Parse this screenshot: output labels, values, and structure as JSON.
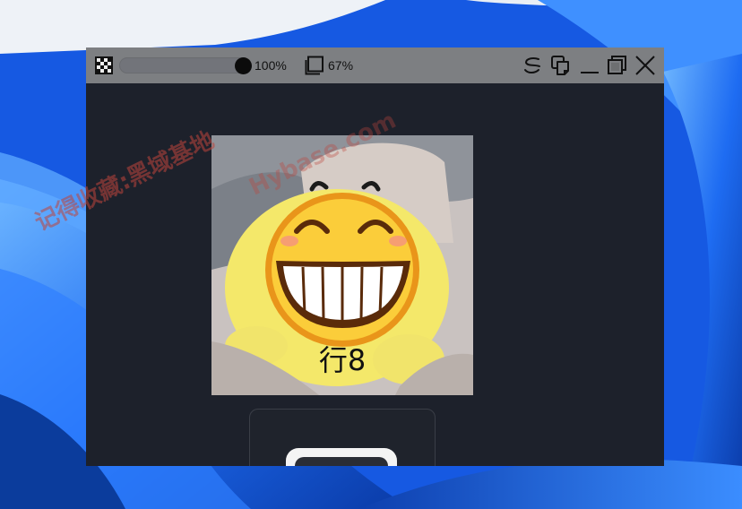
{
  "toolbar": {
    "opacity_label": "100%",
    "opacity_value": 1.0,
    "zoom_label": "67%"
  },
  "image": {
    "caption": "行8",
    "watermark_line1": "记得收藏:黑域基地",
    "watermark_line2": "Hybase.com"
  },
  "colors": {
    "desktop_accent": "#1558df",
    "viewer_background": "#1d212b",
    "toolbar_background": "#7d7f82"
  },
  "icons": [
    "checkerboard-icon",
    "zoom-frame-icon",
    "pin-icon",
    "copy-icon",
    "minimize-icon",
    "restore-icon",
    "close-icon"
  ]
}
